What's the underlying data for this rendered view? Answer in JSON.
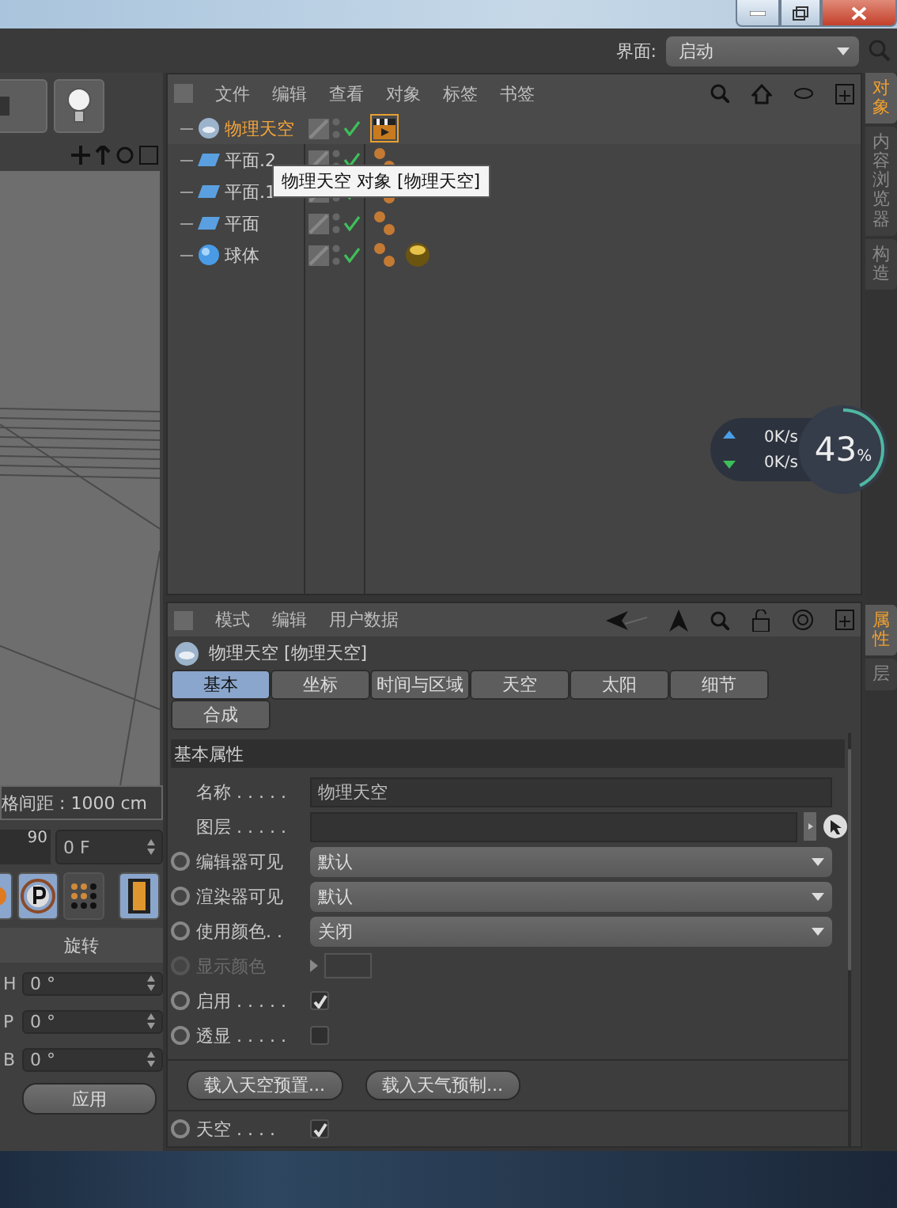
{
  "top_bar": {
    "label": "界面:",
    "layout": "启动"
  },
  "left_panel": {
    "grid_spacing": "格间距 : 1000 cm",
    "ruler_value": "90",
    "frame": "0 F",
    "section": "旋转",
    "rotation": [
      {
        "axis": "H",
        "value": "0 °"
      },
      {
        "axis": "P",
        "value": "0 °"
      },
      {
        "axis": "B",
        "value": "0 °"
      }
    ],
    "apply": "应用"
  },
  "object_manager": {
    "menu": [
      "文件",
      "编辑",
      "查看",
      "对象",
      "标签",
      "书签"
    ],
    "objects": [
      {
        "name": "物理天空",
        "kind": "sky",
        "selected": true,
        "enabled": true,
        "tags": [
          {
            "kind": "scene",
            "selected": true
          }
        ]
      },
      {
        "name": "平面.2",
        "kind": "plane",
        "selected": false,
        "enabled": true,
        "tags": [
          {
            "kind": "phong",
            "selected": false
          }
        ]
      },
      {
        "name": "平面.1",
        "kind": "plane",
        "selected": false,
        "enabled": true,
        "tags": [
          {
            "kind": "phong",
            "selected": false
          }
        ]
      },
      {
        "name": "平面",
        "kind": "plane",
        "selected": false,
        "enabled": true,
        "tags": [
          {
            "kind": "phong",
            "selected": false
          }
        ]
      },
      {
        "name": "球体",
        "kind": "sphere",
        "selected": false,
        "enabled": true,
        "tags": [
          {
            "kind": "phong",
            "selected": false
          },
          {
            "kind": "material",
            "selected": false
          }
        ]
      }
    ],
    "tooltip": "物理天空 对象 [物理天空]"
  },
  "network_monitor": {
    "upload": "0K/s",
    "download": "0K/s",
    "percent": "43",
    "unit": "%",
    "level": 0.43
  },
  "attribute_manager": {
    "menu": [
      "模式",
      "编辑",
      "用户数据"
    ],
    "title": "物理天空 [物理天空]",
    "tabs": [
      {
        "label": "基本",
        "selected": true
      },
      {
        "label": "坐标",
        "selected": false
      },
      {
        "label": "时间与区域",
        "selected": false
      },
      {
        "label": "天空",
        "selected": false
      },
      {
        "label": "太阳",
        "selected": false
      },
      {
        "label": "细节",
        "selected": false
      },
      {
        "label": "合成",
        "selected": false
      }
    ],
    "section": "基本属性",
    "fields": [
      {
        "kind": "text",
        "label": "名称 . . . . .",
        "value": "物理天空",
        "animatable": false,
        "disabled": false
      },
      {
        "kind": "layer",
        "label": "图层 . . . . .",
        "animatable": false,
        "disabled": false
      },
      {
        "kind": "dropdown",
        "label": "编辑器可见",
        "value": "默认",
        "animatable": true,
        "disabled": false
      },
      {
        "kind": "dropdown",
        "label": "渲染器可见",
        "value": "默认",
        "animatable": true,
        "disabled": false
      },
      {
        "kind": "dropdown",
        "label": "使用颜色. .",
        "value": "关闭",
        "animatable": true,
        "disabled": false
      },
      {
        "kind": "color",
        "label": "显示颜色",
        "animatable": true,
        "disabled": true
      },
      {
        "kind": "checkbox",
        "label": "启用 . . . . .",
        "checked": true,
        "animatable": true,
        "disabled": false
      },
      {
        "kind": "checkbox",
        "label": "透显 . . . . .",
        "checked": false,
        "animatable": true,
        "disabled": false
      }
    ],
    "buttons": [
      "载入天空预置...",
      "载入天气预制..."
    ],
    "footer_fields": [
      {
        "kind": "checkbox",
        "label": "天空 . . . .",
        "checked": true,
        "animatable": true,
        "disabled": false
      }
    ]
  },
  "side_tabs_top": [
    {
      "label": "对象",
      "selected": true
    },
    {
      "label": "内容浏览器",
      "selected": false
    },
    {
      "label": "构造",
      "selected": false
    }
  ],
  "side_tabs_bottom": [
    {
      "label": "属性",
      "selected": true
    },
    {
      "label": "层",
      "selected": false
    }
  ]
}
